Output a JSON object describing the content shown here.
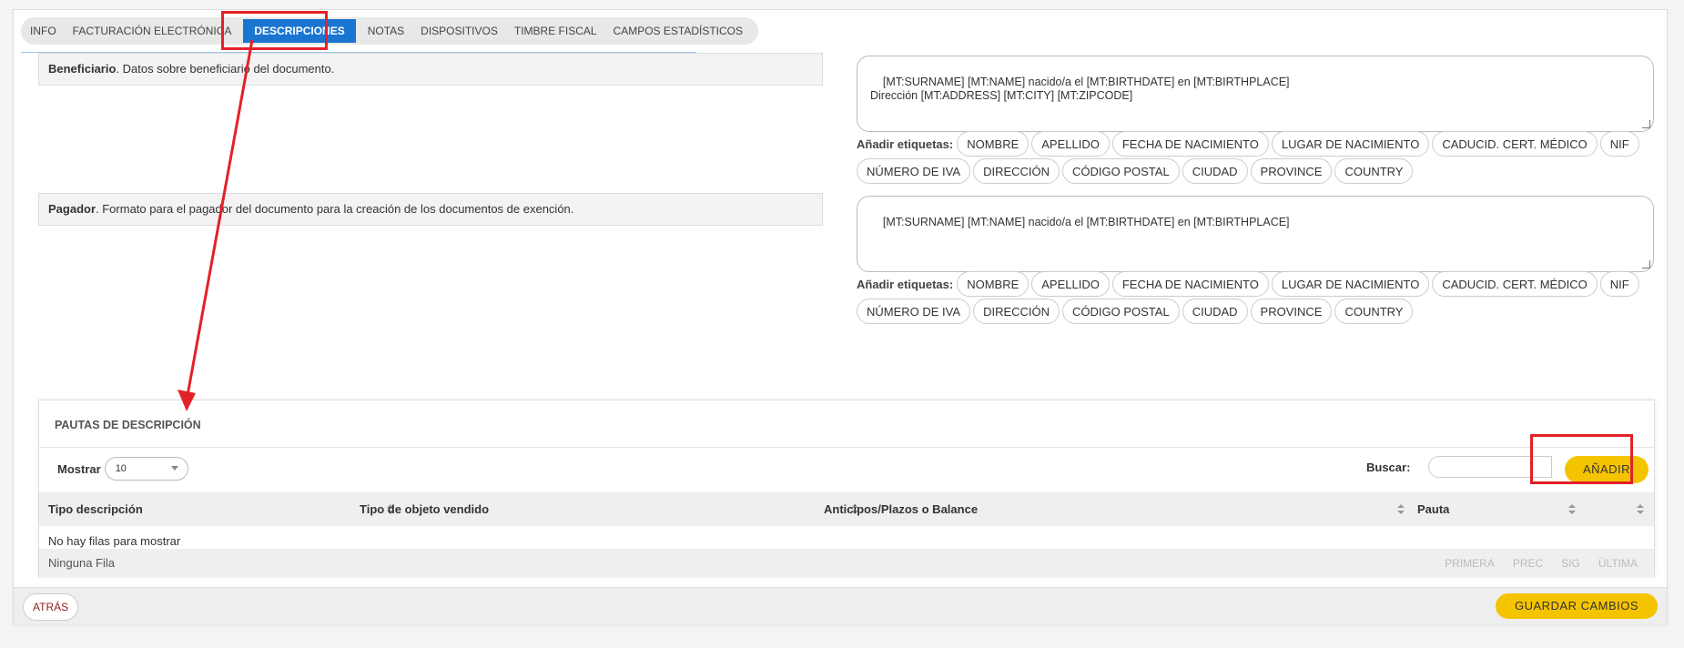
{
  "tabs": [
    {
      "label": "INFO"
    },
    {
      "label": "FACTURACIÓN ELECTRÓNICA"
    },
    {
      "label": "DESCRIPCIONES"
    },
    {
      "label": "NOTAS"
    },
    {
      "label": "DISPOSITIVOS"
    },
    {
      "label": "TIMBRE FISCAL"
    },
    {
      "label": "CAMPOS ESTADÍSTICOS"
    }
  ],
  "beneficiario": {
    "title": "Beneficiario",
    "desc": ". Datos sobre beneficiario del documento.",
    "template": "[MT:SURNAME] [MT:NAME] nacido/a el [MT:BIRTHDATE] en [MT:BIRTHPLACE]\nDirección [MT:ADDRESS] [MT:CITY] [MT:ZIPCODE]"
  },
  "pagador": {
    "title": "Pagador",
    "desc": ". Formato para el pagador del documento para la creación de los documentos de exención.",
    "template": "[MT:SURNAME] [MT:NAME] nacido/a el [MT:BIRTHDATE] en [MT:BIRTHPLACE]"
  },
  "tags": {
    "label": "Añadir etiquetas:",
    "row1": [
      "NOMBRE",
      "APELLIDO",
      "FECHA DE NACIMIENTO",
      "LUGAR DE NACIMIENTO",
      "CADUCID. CERT. MÉDICO",
      "NIF"
    ],
    "row2": [
      "NÚMERO DE IVA",
      "DIRECCIÓN",
      "CÓDIGO POSTAL",
      "CIUDAD",
      "PROVINCE",
      "COUNTRY"
    ]
  },
  "panel": {
    "title": "PAUTAS DE DESCRIPCIÓN",
    "show_label": "Mostrar",
    "show_value": "10",
    "search_label": "Buscar:",
    "add_label": "AÑADIR",
    "columns": [
      "Tipo descripción",
      "Tipo de objeto vendido",
      "Anticipos/Plazos o Balance",
      "Pauta"
    ],
    "empty": "No hay filas para mostrar",
    "footer_info": "Ninguna Fila",
    "pager": [
      "PRIMERA",
      "PREC",
      "SIG",
      "ÚLTIMA"
    ]
  },
  "footer": {
    "back": "ATRÁS",
    "save": "GUARDAR CAMBIOS"
  },
  "colors": {
    "accent": "#1a75d1",
    "button": "#f5c400",
    "highlight": "#e32128"
  }
}
